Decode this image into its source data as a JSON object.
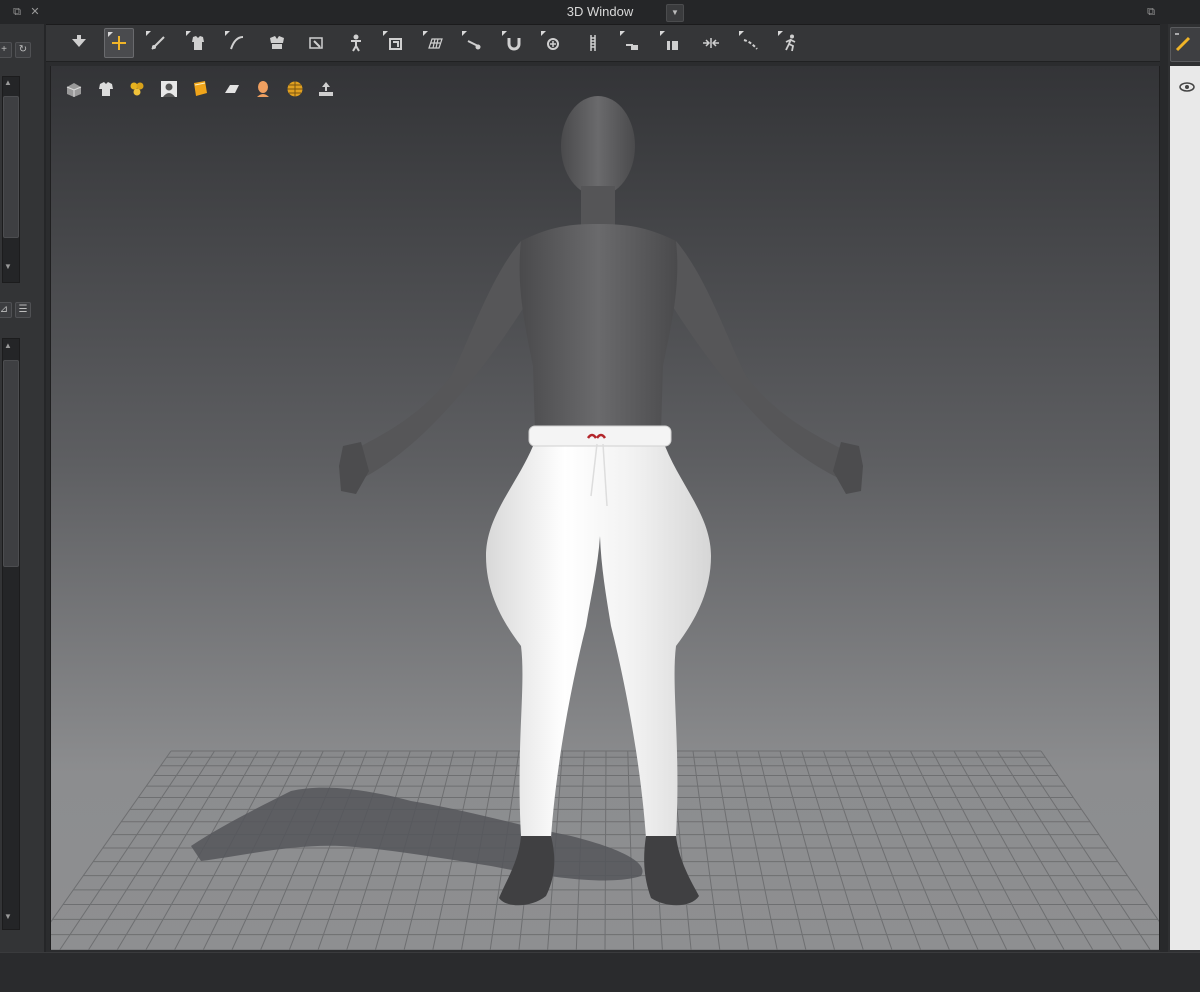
{
  "window": {
    "title": "3D Window",
    "dropdown_icon": "chevron-down-icon"
  },
  "colors": {
    "accent": "#f0b428",
    "toolbar_bg": "#353638",
    "viewport_top": "#333437",
    "viewport_bottom": "#8e8f91",
    "garment": "#f2f2f2",
    "avatar": "#5a5a5c"
  },
  "title_controls": {
    "left": [
      "float-icon",
      "close-icon"
    ],
    "right": [
      "float-icon"
    ]
  },
  "left_panel": {
    "icons": [
      "add-icon",
      "refresh-icon",
      "scroll-up-icon",
      "scroll-down-icon",
      "filter-icon",
      "list-icon",
      "scroll-up-icon",
      "scroll-down-icon"
    ]
  },
  "toolbar": {
    "tools": [
      {
        "icon": "select-move-dropdown-icon",
        "active": false
      },
      {
        "icon": "transform-pattern-icon",
        "active": true
      },
      {
        "icon": "edit-pattern-icon",
        "active": false
      },
      {
        "icon": "select-garment-icon",
        "active": false
      },
      {
        "icon": "edit-curvature-icon",
        "active": false
      },
      {
        "icon": "fold-arrangement-icon",
        "active": false
      },
      {
        "icon": "tack-icon",
        "active": false
      },
      {
        "icon": "avatar-pin-icon",
        "active": false
      },
      {
        "icon": "fold-icon",
        "active": false
      },
      {
        "icon": "grid-mesh-icon",
        "active": false
      },
      {
        "icon": "cut-line-icon",
        "active": false
      },
      {
        "icon": "magnet-icon",
        "active": false
      },
      {
        "icon": "measure-point-icon",
        "active": false
      },
      {
        "icon": "zipper-icon",
        "active": false
      },
      {
        "icon": "stitch-icon",
        "active": false
      },
      {
        "icon": "elastic-icon",
        "active": false
      },
      {
        "icon": "shrink-icon",
        "active": false
      },
      {
        "icon": "seamline-icon",
        "active": false
      },
      {
        "icon": "walk-avatar-icon",
        "active": false
      }
    ]
  },
  "viewport_tools": [
    "shaded-view-icon",
    "garment-view-icon",
    "texture-view-icon",
    "avatar-view-icon",
    "fabric-view-icon",
    "plane-view-icon",
    "skin-view-icon",
    "globe-view-icon",
    "export-icon"
  ],
  "right_panel": {
    "top_icon": "edit-tool-icon",
    "body_icon": "visibility-icon"
  }
}
